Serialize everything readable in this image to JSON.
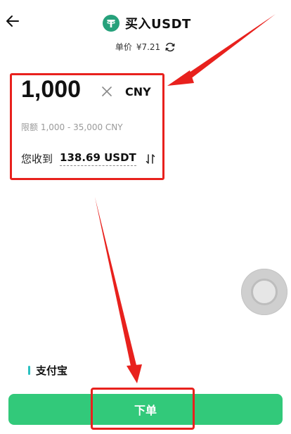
{
  "header": {
    "title": "买入USDT",
    "back_icon": "arrow-left-icon",
    "coin_icon": "tether-icon"
  },
  "price": {
    "label": "单价",
    "value": "¥7.21",
    "icon": "refresh-icon"
  },
  "amount": {
    "value": "1,000",
    "currency": "CNY",
    "clear_icon": "close-icon"
  },
  "limit": {
    "text": "限额 1,000 - 35,000 CNY"
  },
  "receive": {
    "label": "您收到",
    "value": "138.69 USDT",
    "icon": "swap-icon"
  },
  "payment": {
    "method": "支付宝"
  },
  "order": {
    "label": "下单"
  },
  "colors": {
    "accent_green": "#32c97a",
    "annotation_red": "#e8211d",
    "tether_green": "#26a17b"
  }
}
